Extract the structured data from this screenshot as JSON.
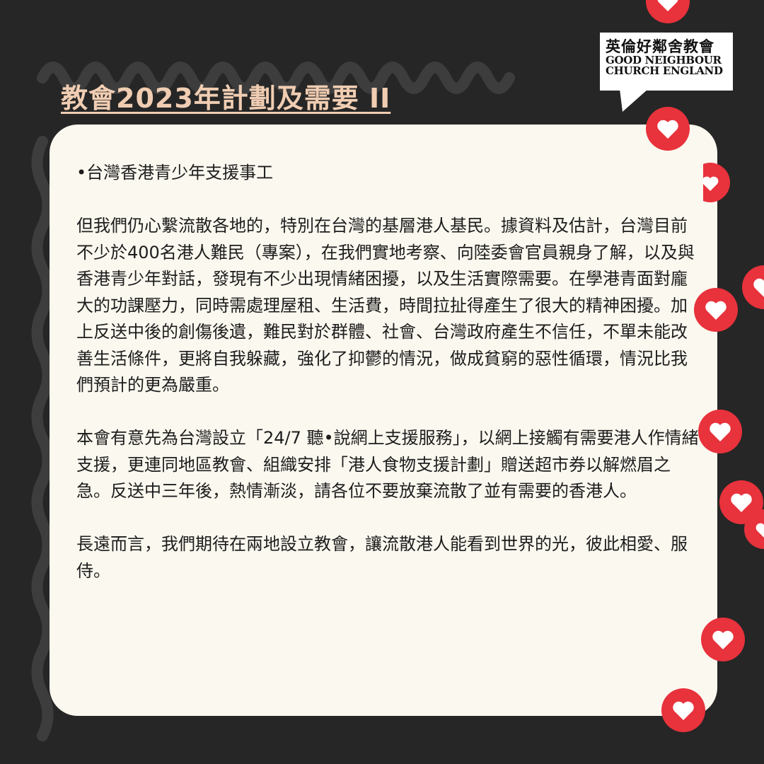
{
  "title": "教會2023年計劃及需要 II",
  "logo": {
    "name_cn": "英倫好鄰舍教會",
    "name_en_line1": "GOOD NEIGHBOUR",
    "name_en_line2": "CHURCH ENGLAND"
  },
  "paragraphs": [
    "•台灣香港青少年支援事工",
    "但我們仍心繫流散各地的，特別在台灣的基層港人基民。據資料及估計，台灣目前不少於400名港人難民（專案），在我們實地考察、向陸委會官員親身了解，以及與香港青少年對話，發現有不少出現情緒困擾，以及生活實際需要。在學港青面對龐大的功課壓力，同時需處理屋租、生活費，時間拉扯得產生了很大的精神困擾。加上反送中後的創傷後遺，難民對於群體、社會、台灣政府產生不信任，不單未能改善生活條件，更將自我躲藏，強化了抑鬱的情況，做成貧窮的惡性循環，情況比我們預計的更為嚴重。",
    "本會有意先為台灣設立「24/7 聽•說網上支援服務」，以網上接觸有需要港人作情緒支援，更連同地區教會、組織安排「港人食物支援計劃」贈送超市券以解燃眉之急。反送中三年後，熱情漸淡，請各位不要放棄流散了並有需要的香港人。",
    "長遠而言，我們期待在兩地設立教會，讓流散港人能看到世界的光，彼此相愛、服侍。"
  ],
  "colors": {
    "background": "#262626",
    "card": "#fbf8ef",
    "title": "#f0cdb2",
    "heart": "#e8323c"
  },
  "decorations": {
    "heart_icon": "heart-icon"
  }
}
